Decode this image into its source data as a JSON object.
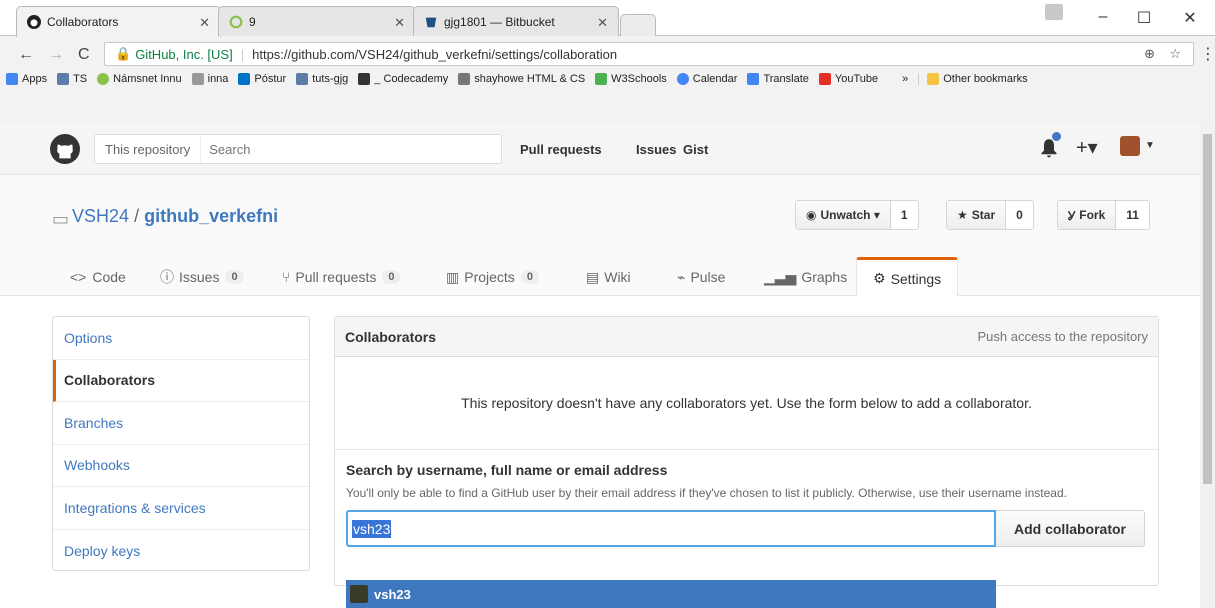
{
  "browser": {
    "tabs": [
      {
        "title": "Collaborators",
        "active": true
      },
      {
        "title": "9",
        "active": false
      },
      {
        "title": "gjg1801 — Bitbucket",
        "active": false
      }
    ],
    "security_label": "GitHub, Inc. [US]",
    "url": "https://github.com/VSH24/github_verkefni/settings/collaboration",
    "bookmarks": [
      "Apps",
      "TS",
      "Námsnet Innu",
      "inna",
      "Póstur",
      "tuts-gjg",
      "_ Codecademy",
      "shayhowe HTML & CS",
      "W3Schools",
      "Calendar",
      "Translate",
      "YouTube"
    ],
    "more_bookmarks": "»",
    "other_bookmarks": "Other bookmarks"
  },
  "header": {
    "search_scope": "This repository",
    "search_placeholder": "Search",
    "nav": [
      "Pull requests",
      "Issues",
      "Gist"
    ]
  },
  "repo": {
    "owner": "VSH24",
    "separator": "/",
    "name": "github_verkefni",
    "unwatch_label": "Unwatch ▾",
    "watch_count": "1",
    "star_label": "Star",
    "star_count": "0",
    "fork_label": "Fork",
    "fork_count": "11",
    "tabs": [
      {
        "label": "Code",
        "count": null
      },
      {
        "label": "Issues",
        "count": "0"
      },
      {
        "label": "Pull requests",
        "count": "0"
      },
      {
        "label": "Projects",
        "count": "0"
      },
      {
        "label": "Wiki",
        "count": null
      },
      {
        "label": "Pulse",
        "count": null
      },
      {
        "label": "Graphs",
        "count": null
      },
      {
        "label": "Settings",
        "count": null
      }
    ]
  },
  "sidebar": {
    "items": [
      "Options",
      "Collaborators",
      "Branches",
      "Webhooks",
      "Integrations & services",
      "Deploy keys"
    ]
  },
  "collaborators": {
    "title": "Collaborators",
    "subtitle": "Push access to the repository",
    "empty_message": "This repository doesn't have any collaborators yet. Use the form below to add a collaborator.",
    "search_label": "Search by username, full name or email address",
    "search_note": "You'll only be able to find a GitHub user by their email address if they've chosen to list it publicly. Otherwise, use their username instead.",
    "input_value": "vsh23",
    "add_button": "Add collaborator",
    "suggestion": "vsh23"
  }
}
